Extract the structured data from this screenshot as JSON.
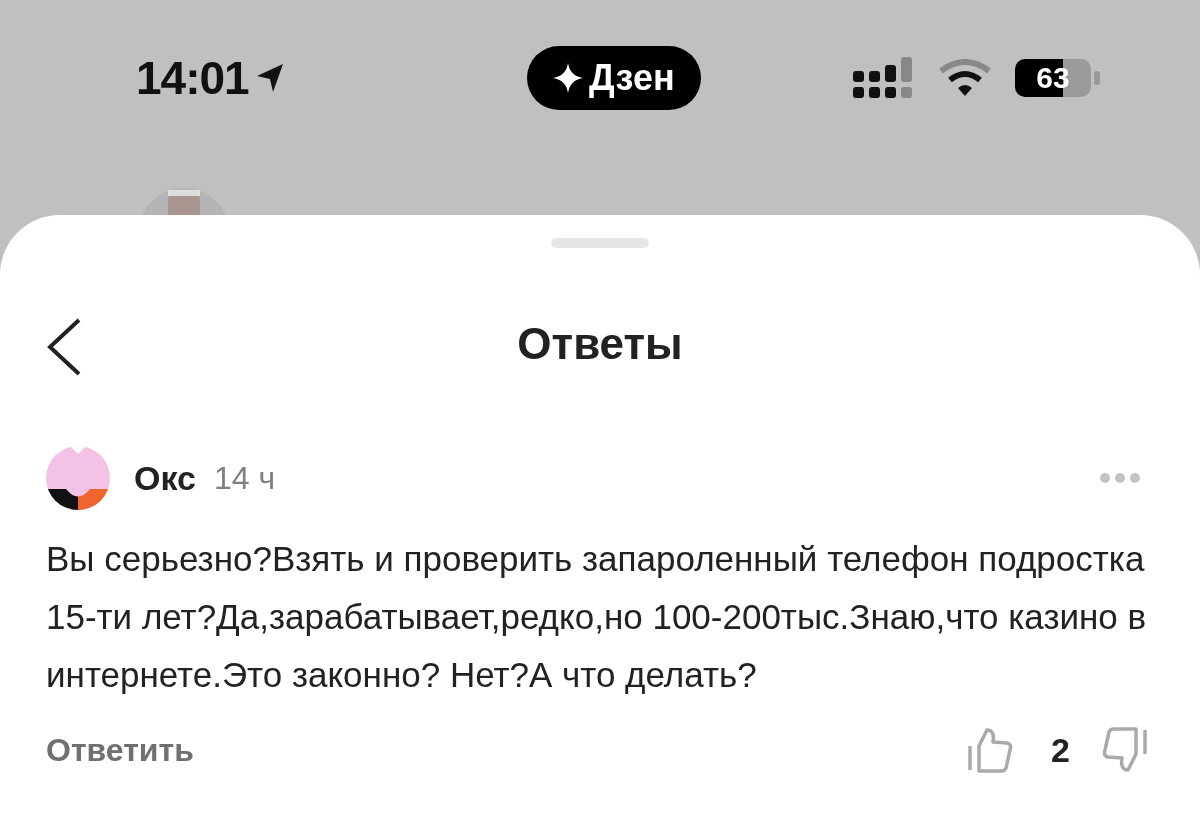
{
  "status_bar": {
    "time": "14:01",
    "app_badge": "Дзен",
    "battery": "63"
  },
  "sheet": {
    "title": "Ответы"
  },
  "comment": {
    "author": "Окс",
    "time": "14 ч",
    "text": "Вы серьезно?Взять и проверить запароленный телефон подростка 15-ти лет?Да,зарабатывает,редко,но 100-200тыс.Знаю,что казино в интернете.Это законно? Нет?А что делать?",
    "reply": "Ответить",
    "likes": "2"
  }
}
